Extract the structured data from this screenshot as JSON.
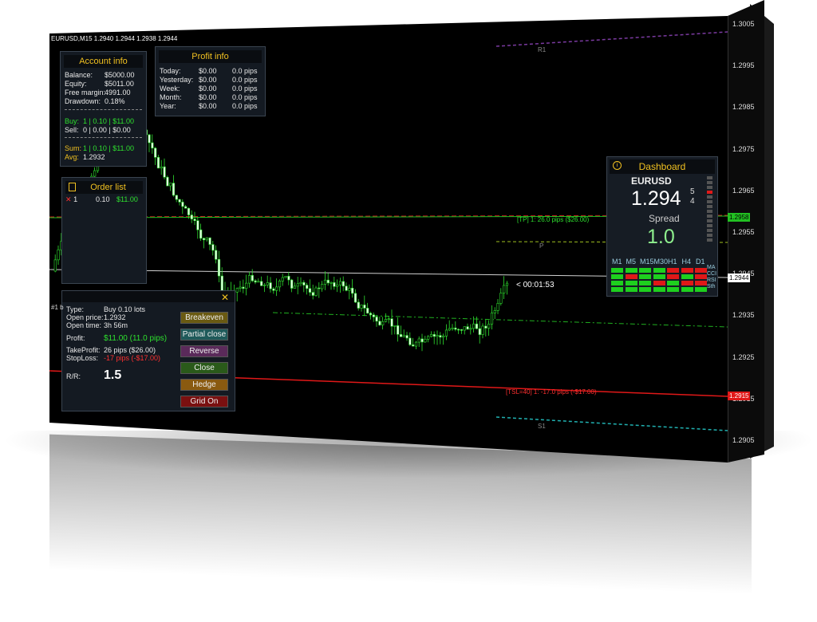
{
  "symbol_bar": "EURUSD,M15  1.2940 1.2944 1.2938 1.2944",
  "account": {
    "title": "Account info",
    "rows": [
      {
        "label": "Balance:",
        "value": "$5000.00"
      },
      {
        "label": "Equity:",
        "value": "$5011.00"
      },
      {
        "label": "Free margin:",
        "value": "4991.00"
      },
      {
        "label": "Drawdown:",
        "value": "0.18%"
      }
    ],
    "buy_label": "Buy:",
    "buy_value": "1 | 0.10 | $11.00",
    "sell_label": "Sell:",
    "sell_value": "0 | 0.00 | $0.00",
    "sum_label": "Sum:",
    "sum_value": "1 | 0.10 | $11.00",
    "avg_label": "Avg:",
    "avg_value": "1.2932"
  },
  "profit": {
    "title": "Profit info",
    "rows": [
      {
        "label": "Today:",
        "usd": "$0.00",
        "pips": "0.0 pips"
      },
      {
        "label": "Yesterday:",
        "usd": "$0.00",
        "pips": "0.0 pips"
      },
      {
        "label": "Week:",
        "usd": "$0.00",
        "pips": "0.0 pips"
      },
      {
        "label": "Month:",
        "usd": "$0.00",
        "pips": "0.0 pips"
      },
      {
        "label": "Year:",
        "usd": "$0.00",
        "pips": "0.0 pips"
      }
    ]
  },
  "orders": {
    "title": "Order list",
    "items": [
      {
        "id": "1",
        "lots": "0.10",
        "profit": "$11.00"
      }
    ]
  },
  "order_panel": {
    "ticket_label": "#1 b",
    "close_glyph": "✕",
    "type_label": "Type:",
    "type_value": "Buy  0.10 lots",
    "open_price_label": "Open price:",
    "open_price_value": "1.2932",
    "open_time_label": "Open time:",
    "open_time_value": "3h 56m",
    "profit_label": "Profit:",
    "profit_value": "$11.00 (11.0 pips)",
    "tp_label": "TakeProfit:",
    "tp_value": "26 pips ($26.00)",
    "sl_label": "StopLoss:",
    "sl_value": "-17 pips (-$17.00)",
    "rr_label": "R/R:",
    "rr_value": "1.5",
    "buttons": [
      {
        "label": "Breakeven",
        "color": "#6a5a12"
      },
      {
        "label": "Partial close",
        "color": "#1f5a5a"
      },
      {
        "label": "Reverse",
        "color": "#5a2a5a"
      },
      {
        "label": "Close",
        "color": "#2a5a1a"
      },
      {
        "label": "Hedge",
        "color": "#8a5a10"
      },
      {
        "label": "Grid On",
        "color": "#7a1010"
      }
    ]
  },
  "dashboard": {
    "title": "Dashboard",
    "symbol": "EURUSD",
    "price_main": "1.294",
    "price_sup": "5",
    "price_sub": "4",
    "spread_label": "Spread",
    "spread_value": "1.0",
    "timeframes": [
      "M1",
      "M5",
      "M15",
      "M30",
      "H1",
      "H4",
      "D1"
    ],
    "indicators": [
      "MA",
      "CCI",
      "RSI",
      "Sth"
    ],
    "signals": [
      [
        "g",
        "g",
        "g",
        "g",
        "r",
        "r",
        "r"
      ],
      [
        "g",
        "r",
        "g",
        "g",
        "r",
        "g",
        "r"
      ],
      [
        "g",
        "g",
        "g",
        "r",
        "g",
        "r",
        "r"
      ],
      [
        "g",
        "g",
        "g",
        "g",
        "g",
        "g",
        "g"
      ]
    ],
    "colors": {
      "green": "#1ed01e",
      "red": "#e01818"
    }
  },
  "chart_lines": {
    "tp_label": "[TP] 1: 26.0 pips ($26.00)",
    "tsl_label": "[TSL=40] 1: -17.0 pips (-$17.00)",
    "timer": "< 00:01:53",
    "r1": "R1",
    "p": "P",
    "s1": "S1"
  },
  "price_axis": {
    "labels": [
      "1.3005",
      "1.2995",
      "1.2985",
      "1.2975",
      "1.2965",
      "1.2955",
      "1.2945",
      "1.2935",
      "1.2925",
      "1.2915",
      "1.2905"
    ],
    "tp_price": "1.2958",
    "bid_price": "1.2944",
    "sl_price": "1.2915"
  }
}
